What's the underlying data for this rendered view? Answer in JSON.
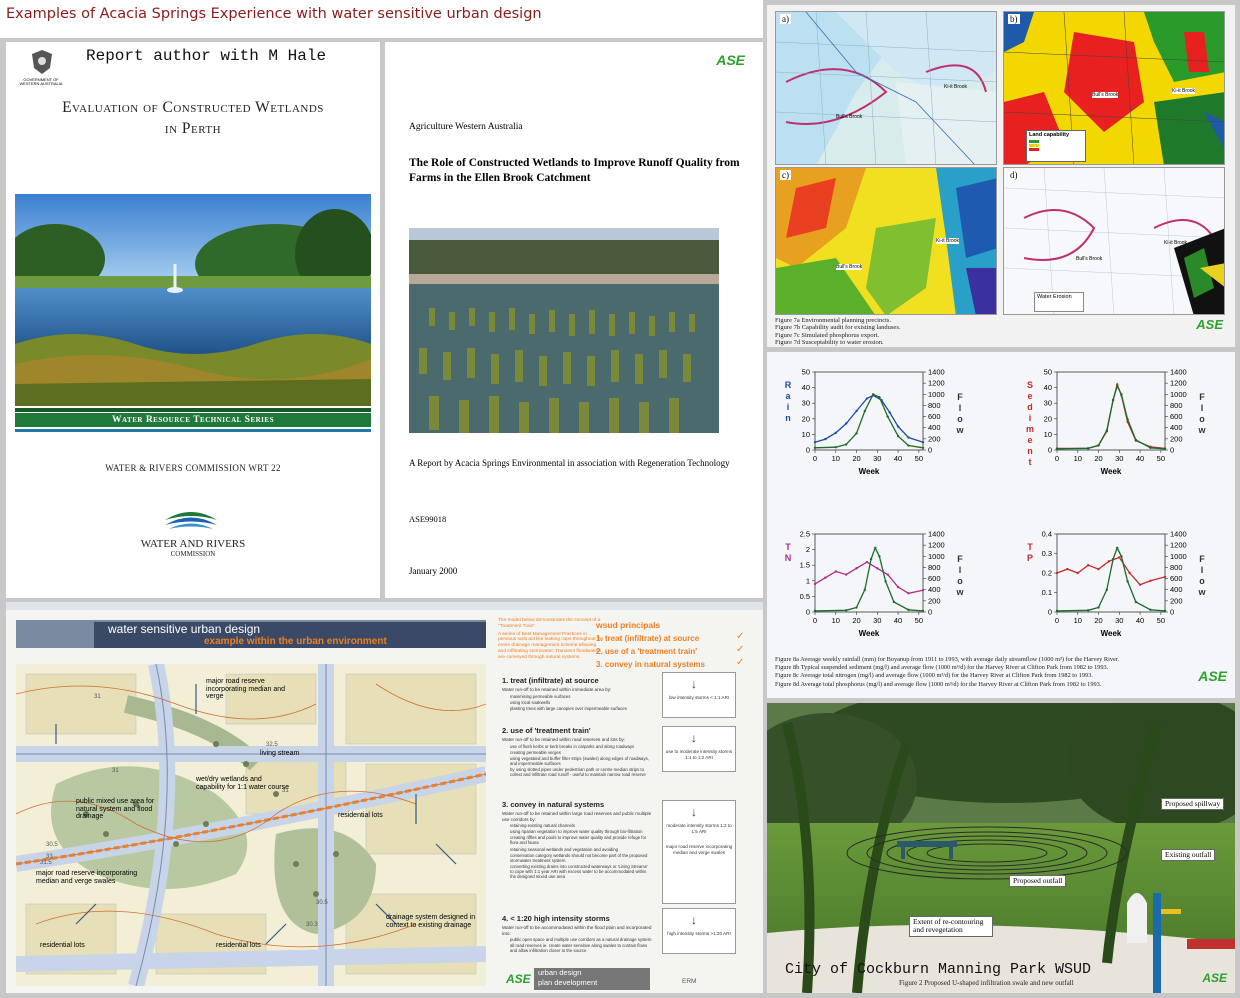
{
  "header": {
    "title": "Examples of Acacia Springs Experience with water sensitive urban design"
  },
  "cover1": {
    "gov_label": "GOVERNMENT OF WESTERN AUSTRALIA",
    "author_note": "Report author with M Hale",
    "title_line1": "Evaluation of Constructed Wetlands",
    "title_line2": "in Perth",
    "series_band": "Water Resource Technical Series",
    "commission_ref": "WATER & RIVERS COMMISSION WRT 22",
    "logo_line1": "WATER AND RIVERS",
    "logo_line2": "COMMISSION"
  },
  "cover2": {
    "ase_logo": "ASE",
    "publisher": "Agriculture Western Australia",
    "title": "The Role of Constructed Wetlands to Improve Runoff Quality from Farms in the Ellen Brook Catchment",
    "report_line": "A Report by Acacia Springs Environmental in association with Regeneration Technology",
    "ref": "ASE99018",
    "date": "January 2000"
  },
  "maps": {
    "labels": [
      "a)",
      "b)",
      "c)",
      "d)"
    ],
    "place_bulls_brook": "Bull's Brook",
    "place_ki_brook": "Ki-it Brook",
    "legend_b_title": "Land capability",
    "legend_d_title": "Water Erosion",
    "captions": [
      "Figure 7a  Environmental planning precincts.",
      "Figure 7b Capability audit for existing landuses.",
      "Figure 7c Simulated phosphorus export.",
      "Figure 7d Susceptability to water erosion."
    ],
    "ase_logo": "ASE"
  },
  "charts": {
    "flow_label": "Flow",
    "captions": [
      "Figure 8a  Average weekly rainfall (mm) for Boyanup from 1911 to 1993, with average daily streamflow (1000 m³) for the Harvey River.",
      "Figure 8b  Typical suspended sediment (mg/l) and average flow (1000 m³/d) for the Harvey River at Clifton Park from 1982 to 1993.",
      "Figure 8c  Average total nitrogen (mg/l) and average flow (1000 m³/d) for the Harvey River at Clifton Park from 1982 to 1993.",
      "Figure 8d  Average total phosphorus (mg/l) and average flow (1000 m³/d) for the Harvey River at Clifton Park from 1982 to 1993."
    ],
    "ase_logo": "ASE"
  },
  "chart_data": [
    {
      "type": "line",
      "title": "",
      "left_label": "Rain",
      "xlabel": "Week",
      "ylabel": "Rain",
      "y2label": "Flow",
      "x_ticks": [
        0,
        10,
        20,
        30,
        40,
        50
      ],
      "y_ticks": [
        0,
        10,
        20,
        30,
        40,
        50
      ],
      "y2_ticks": [
        0,
        200,
        400,
        600,
        800,
        1000,
        1200,
        1400
      ],
      "xlim": [
        0,
        52
      ],
      "ylim": [
        0,
        50
      ],
      "y2lim": [
        0,
        1400
      ],
      "series": [
        {
          "kind": "primary",
          "color": "#1f4aa8",
          "x": [
            0,
            5,
            10,
            15,
            20,
            25,
            28,
            32,
            36,
            40,
            45,
            52
          ],
          "y": [
            5,
            7,
            11,
            17,
            25,
            33,
            35,
            32,
            24,
            15,
            8,
            5
          ]
        },
        {
          "kind": "flow",
          "color": "#1d6b2a",
          "x": [
            0,
            10,
            15,
            20,
            24,
            28,
            31,
            35,
            40,
            45,
            52
          ],
          "y": [
            40,
            50,
            100,
            300,
            700,
            1000,
            950,
            600,
            250,
            80,
            40
          ]
        }
      ]
    },
    {
      "type": "line",
      "title": "",
      "left_label": "Sediment",
      "xlabel": "Week",
      "ylabel": "Sediment",
      "y2label": "Flow",
      "x_ticks": [
        0,
        10,
        20,
        30,
        40,
        50
      ],
      "y_ticks": [
        0,
        10,
        20,
        30,
        40,
        50
      ],
      "y2_ticks": [
        0,
        200,
        400,
        600,
        800,
        1000,
        1200,
        1400
      ],
      "xlim": [
        0,
        52
      ],
      "ylim": [
        0,
        50
      ],
      "y2lim": [
        0,
        1400
      ],
      "series": [
        {
          "kind": "primary",
          "color": "#c42a2a",
          "x": [
            0,
            15,
            20,
            24,
            27,
            29,
            31,
            34,
            38,
            45,
            52
          ],
          "y": [
            1,
            1,
            3,
            12,
            32,
            42,
            35,
            18,
            6,
            2,
            1
          ]
        },
        {
          "kind": "flow",
          "color": "#1d6b2a",
          "x": [
            0,
            15,
            20,
            24,
            27,
            29,
            31,
            34,
            38,
            45,
            52
          ],
          "y": [
            20,
            30,
            80,
            350,
            900,
            1150,
            1000,
            550,
            180,
            40,
            20
          ]
        }
      ]
    },
    {
      "type": "line",
      "title": "",
      "left_label": "TN",
      "xlabel": "Week",
      "ylabel": "TN",
      "y2label": "Flow",
      "x_ticks": [
        0,
        10,
        20,
        30,
        40,
        50
      ],
      "y_ticks": [
        0,
        0.5,
        1,
        1.5,
        2,
        2.5
      ],
      "y2_ticks": [
        0,
        200,
        400,
        600,
        800,
        1000,
        1200,
        1400
      ],
      "xlim": [
        0,
        52
      ],
      "ylim": [
        0,
        2.5
      ],
      "y2lim": [
        0,
        1400
      ],
      "series": [
        {
          "kind": "primary",
          "color": "#b02a8a",
          "x": [
            0,
            5,
            10,
            15,
            20,
            25,
            30,
            35,
            40,
            45,
            52
          ],
          "y": [
            0.9,
            1.1,
            1.3,
            1.2,
            1.4,
            1.6,
            1.4,
            1.2,
            0.8,
            0.6,
            0.7
          ]
        },
        {
          "kind": "flow",
          "color": "#1d6b2a",
          "x": [
            0,
            15,
            20,
            24,
            27,
            29,
            31,
            34,
            38,
            45,
            52
          ],
          "y": [
            20,
            30,
            80,
            400,
            950,
            1150,
            1000,
            550,
            180,
            40,
            20
          ]
        }
      ]
    },
    {
      "type": "line",
      "title": "",
      "left_label": "TP",
      "xlabel": "Week",
      "ylabel": "TP",
      "y2label": "Flow",
      "x_ticks": [
        0,
        10,
        20,
        30,
        40,
        50
      ],
      "y_ticks": [
        0,
        0.1,
        0.2,
        0.3,
        0.4
      ],
      "y2_ticks": [
        0,
        200,
        400,
        600,
        800,
        1000,
        1200,
        1400
      ],
      "xlim": [
        0,
        52
      ],
      "ylim": [
        0,
        0.4
      ],
      "y2lim": [
        0,
        1400
      ],
      "series": [
        {
          "kind": "primary",
          "color": "#c42a2a",
          "x": [
            0,
            5,
            10,
            15,
            20,
            25,
            30,
            35,
            40,
            45,
            52
          ],
          "y": [
            0.2,
            0.22,
            0.2,
            0.24,
            0.22,
            0.26,
            0.28,
            0.2,
            0.14,
            0.16,
            0.18
          ]
        },
        {
          "kind": "flow",
          "color": "#1d6b2a",
          "x": [
            0,
            15,
            20,
            24,
            27,
            29,
            31,
            34,
            38,
            45,
            52
          ],
          "y": [
            20,
            30,
            80,
            400,
            950,
            1150,
            1000,
            550,
            180,
            40,
            20
          ]
        }
      ]
    }
  ],
  "wsud": {
    "title": "water sensitive urban design",
    "subtitle": "example within the urban environment",
    "intro_orange": "The model below demonstrates the concept of a \"Treatment Train\".",
    "intro_orange2": "A series of Best Management Practices in pervious soils act like leaking cups throughout the entire drainage management scheme allowing and infiltrating stormwater. Transient floodwaters are conveyed through natural systems.",
    "principles_title": "wsud principals",
    "principles": [
      "1. treat (infiltrate) at source",
      "2. use of a 'treatment train'",
      "3. convey in natural systems"
    ],
    "map_labels": [
      "major road reserve incorporating median and verge",
      "living stream",
      "wet/dry wetlands and capability for 1:1 water course",
      "residential lots",
      "public mixed use area for natural system and flood drainage",
      "major road reserve incorporating median and verge swales",
      "residential lots",
      "residential lots",
      "drainage system designed in context to existing drainage"
    ],
    "contours": [
      "31",
      "32.5",
      "31",
      "31",
      "30.5",
      "33",
      "31.5",
      "30.5",
      "30.3"
    ],
    "sections": [
      {
        "heading": "1. treat (infiltrate) at source",
        "intro": "Water run-off to be retained within immediate area by:",
        "bullets": [
          "maximising permeable surfaces",
          "using local soakwells",
          "planting trees with large canopies over impermeable surfaces"
        ],
        "diagram": "low intensity storms < 1:1 ARI"
      },
      {
        "heading": "2. use of 'treatment train'",
        "intro": "Water run-off to be retained within road reserves and lots by:",
        "bullets": [
          "use of flush kerbs or kerb breaks in carparks and along roadways",
          "creating permeable verges",
          "using vegetated and buffer filter strips (swales) along edges of roadways, and impermeable surfaces",
          "by using slotted pipes under pedestrian path or centre median strips to collect and infiltrate road runoff - useful to maintain narrow road reserve"
        ],
        "diagram": "use to moderate intensity storms 1:1 to 1:2 ARI"
      },
      {
        "heading": "3. convey in natural systems",
        "intro": "Water run-off to be retained within large road reserves and public multiple use corridors by:",
        "bullets": [
          "retaining existing natural channels",
          "using riparian vegetation to improve water quality through bio-filtration",
          "creating riffles and pools to improve water quality and provide refuge for flora and fauna",
          "retaining seasonal wetlands and vegetation and avoiding",
          "conservation category wetlands should not become part of the proposed stormwater treatment system",
          "converting existing drains into constructed waterways or 'Living Streams' to cope with 1:1 year ARI with excess water to be accommodated within the designed mixed use area"
        ],
        "diagram": "moderate intensity storms 1:2 to 1:5 ARI",
        "diagram2": "major road reserve incorporating median and verge swales"
      },
      {
        "heading": "4. < 1:20 high intensity storms",
        "intro": "Water run-off to be accommodated within the flood plain and incorporated into:",
        "bullets": [
          "public open space and multiple use corridors as a natural drainage system",
          "all road reserves ie. create water sensitive along swales to contain flows and allow infiltration closer to the source"
        ],
        "diagram": "high intensity storms >1:20 ARI"
      }
    ],
    "logo_ase": "ASE",
    "logo_udp1": "urban design",
    "logo_udp2": "plan development",
    "logo_erm": "ERM"
  },
  "park": {
    "title": "City of Cockburn Manning Park WSUD",
    "callouts": [
      "Proposed spillway",
      "Existing outfall",
      "Proposed outfall",
      "Extent of re-contouring and revegetation"
    ],
    "caption": "Figure 2    Proposed U-shaped infiltration swale and new outfall",
    "ase_logo": "ASE"
  }
}
